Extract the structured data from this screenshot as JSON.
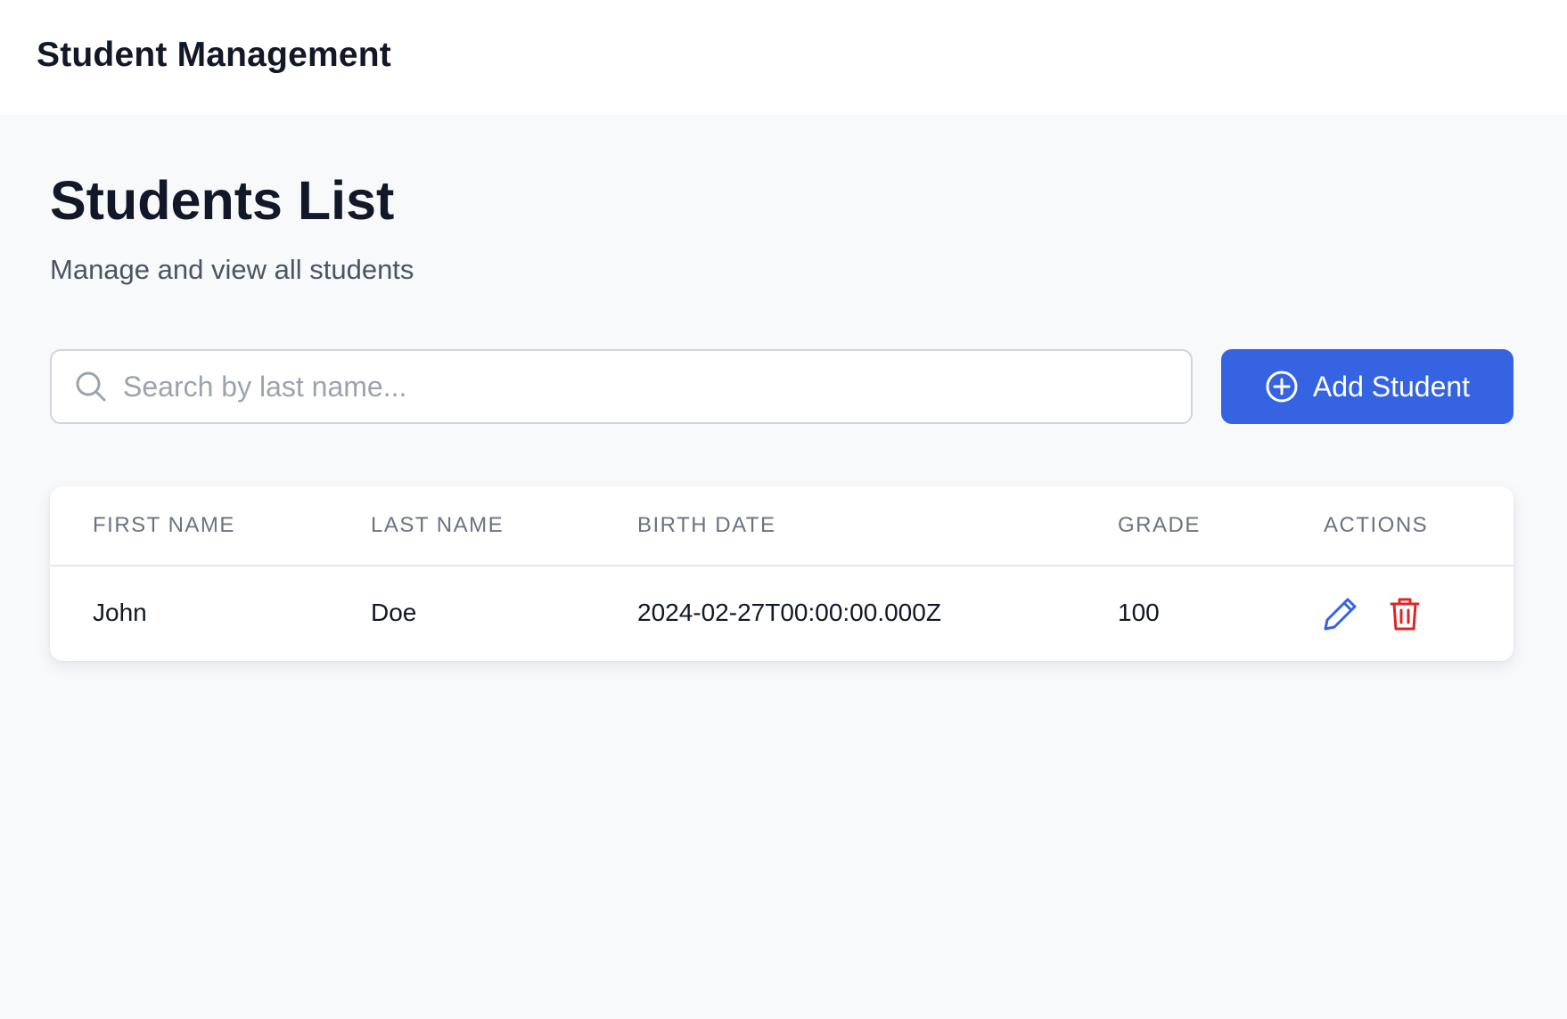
{
  "header": {
    "app_title": "Student Management"
  },
  "page": {
    "title": "Students List",
    "subtitle": "Manage and view all students"
  },
  "search": {
    "placeholder": "Search by last name...",
    "value": "",
    "icon": "search-icon"
  },
  "add_button": {
    "label": "Add Student",
    "icon": "plus-circle-icon",
    "color": "#3563e2"
  },
  "table": {
    "columns": [
      "FIRST NAME",
      "LAST NAME",
      "BIRTH DATE",
      "GRADE",
      "ACTIONS"
    ],
    "rows": [
      {
        "first_name": "John",
        "last_name": "Doe",
        "birth_date": "2024-02-27T00:00:00.000Z",
        "grade": "100",
        "actions": [
          "pencil-icon",
          "trash-icon"
        ]
      }
    ]
  },
  "colors": {
    "edit": "#3563e2",
    "delete": "#dc2626"
  }
}
